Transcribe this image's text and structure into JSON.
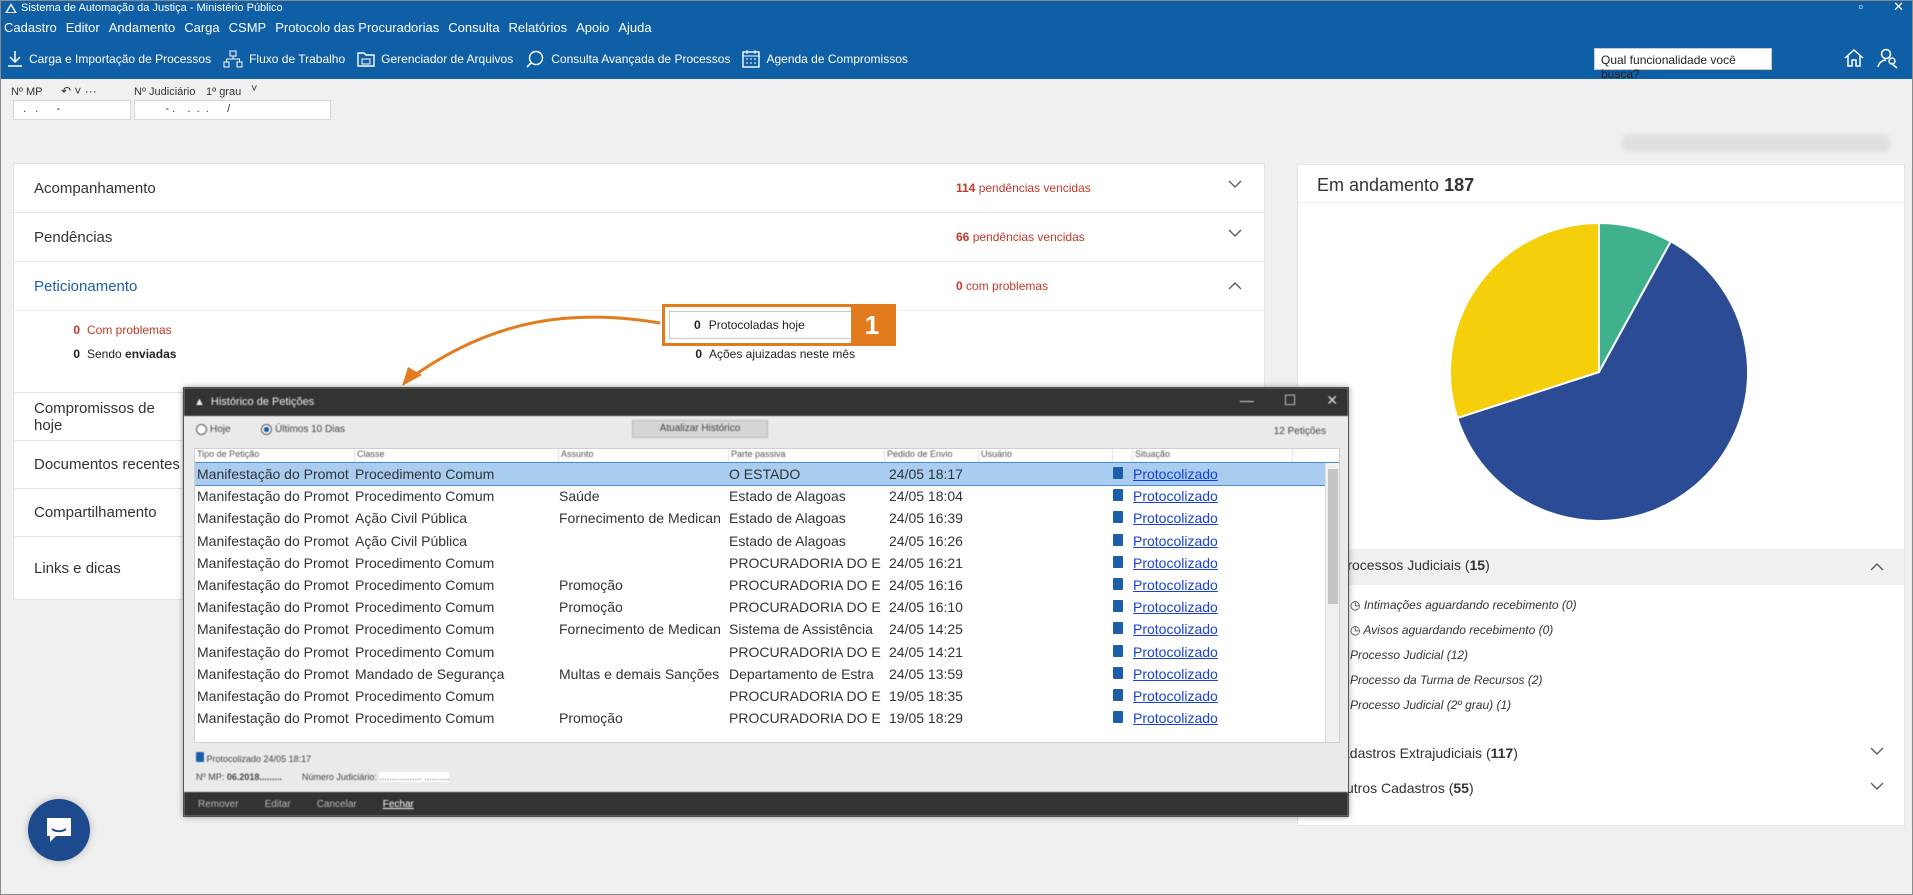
{
  "window": {
    "title": "Sistema de Automação da Justiça - Ministério Público"
  },
  "menu": [
    "Cadastro",
    "Editor",
    "Andamento",
    "Carga",
    "CSMP",
    "Protocolo das Procuradorias",
    "Consulta",
    "Relatórios",
    "Apoio",
    "Ajuda"
  ],
  "toolbar": {
    "items": [
      "Carga e Importação de Processos",
      "Fluxo de Trabalho",
      "Gerenciador de Arquivos",
      "Consulta Avançada de Processos",
      "Agenda de Compromissos"
    ],
    "search_placeholder": "Qual funcionalidade você busca?"
  },
  "identifiers": {
    "mp_label": "Nº MP",
    "mp_value": " .   .      -",
    "judicial_label": "Nº Judiciário",
    "grade": "1º grau",
    "judicial_value": "        - .    .  .  .      /"
  },
  "accordion": {
    "acompanhamento": {
      "title": "Acompanhamento",
      "count": "114",
      "suffix": "pendências vencidas"
    },
    "pendencias": {
      "title": "Pendências",
      "count": "66",
      "suffix": "pendências vencidas"
    },
    "peticionamento": {
      "title": "Peticionamento",
      "count": "0",
      "suffix": "com problemas",
      "com_problemas_count": "0",
      "com_problemas_label": "Com problemas",
      "sendo_count": "0",
      "sendo_label": "Sendo",
      "sendo_bold": "enviadas",
      "protocoladas_count": "0",
      "protocoladas_label": "Protocoladas hoje",
      "acoes_count": "0",
      "acoes_label": "Ações ajuizadas neste mês"
    },
    "others": [
      "Compromissos de hoje",
      "Documentos recentes",
      "Compartilhamento",
      "Links e dicas"
    ]
  },
  "callout_number": "1",
  "right_panel": {
    "heading": "Em andamento",
    "total": "187",
    "pie": [
      {
        "label": "teal",
        "value": 8,
        "color": "#3fb28d"
      },
      {
        "label": "blue",
        "value": 62,
        "color": "#2b4c95"
      },
      {
        "label": "yellow",
        "value": 30,
        "color": "#f4cf0a"
      }
    ],
    "proc_judiciais_label": "Processos Judiciais (",
    "proc_judiciais_count": "15",
    "proc_list": [
      "Intimações aguardando recebimento (0)",
      "Avisos aguardando recebimento (0)",
      "Processo Judicial (12)",
      "Processo da Turma de Recursos (2)",
      "Processo Judicial (2º grau) (1)"
    ],
    "cad_extra_label": "adastros Extrajudiciais (",
    "cad_extra_count": "117",
    "outros_label": "utros Cadastros (",
    "outros_count": "55"
  },
  "dialog": {
    "title": "Histórico de Petições",
    "opt_hoje": "Hoje",
    "opt_10dias": "Últimos 10 Dias",
    "refresh_button": "Atualizar Histórico",
    "count_label": "12 Petições",
    "columns": [
      "Tipo de Petição",
      "Classe",
      "Assunto",
      "Parte passiva",
      "Pedido de Envio",
      "Usuário",
      "",
      "Situação"
    ],
    "rows": [
      [
        "Manifestação do Promot",
        "Procedimento Comum",
        "",
        "O ESTADO",
        "24/05 18:17",
        "Protocolizado"
      ],
      [
        "Manifestação do Promot",
        "Procedimento Comum",
        "Saúde",
        "Estado de Alagoas",
        "24/05 18:04",
        "Protocolizado"
      ],
      [
        "Manifestação do Promot",
        "Ação Civil Pública",
        "Fornecimento de Medican",
        "Estado de Alagoas",
        "24/05 16:39",
        "Protocolizado"
      ],
      [
        "Manifestação do Promot",
        "Ação Civil Pública",
        "",
        "Estado de Alagoas",
        "24/05 16:26",
        "Protocolizado"
      ],
      [
        "Manifestação do Promot",
        "Procedimento Comum",
        "",
        "PROCURADORIA DO E",
        "24/05 16:21",
        "Protocolizado"
      ],
      [
        "Manifestação do Promot",
        "Procedimento Comum",
        "Promoção",
        "PROCURADORIA DO E",
        "24/05 16:16",
        "Protocolizado"
      ],
      [
        "Manifestação do Promot",
        "Procedimento Comum",
        "Promoção",
        "PROCURADORIA DO E",
        "24/05 16:10",
        "Protocolizado"
      ],
      [
        "Manifestação do Promot",
        "Procedimento Comum",
        "Fornecimento de Medican",
        "Sistema de Assistência",
        "24/05 14:25",
        "Protocolizado"
      ],
      [
        "Manifestação do Promot",
        "Procedimento Comum",
        "",
        "PROCURADORIA DO E",
        "24/05 14:21",
        "Protocolizado"
      ],
      [
        "Manifestação do Promot",
        "Mandado de Segurança",
        "Multas e demais Sanções",
        "Departamento de Estra",
        "24/05 13:59",
        "Protocolizado"
      ],
      [
        "Manifestação do Promot",
        "Procedimento Comum",
        "",
        "PROCURADORIA DO E",
        "19/05 18:35",
        "Protocolizado"
      ],
      [
        "Manifestação do Promot",
        "Procedimento Comum",
        "Promoção",
        "PROCURADORIA DO E",
        "19/05 18:29",
        "Protocolizado"
      ]
    ],
    "info_line": "Protocolizado 24/05 18:17",
    "nmp_label": "Nº MP:",
    "nmp_value": "06.2018.........",
    "njud_label": "Número Judiciário:",
    "njud_value": ".................  ..........",
    "footer": [
      "Remover",
      "Editar",
      "Cancelar",
      "Fechar"
    ]
  }
}
